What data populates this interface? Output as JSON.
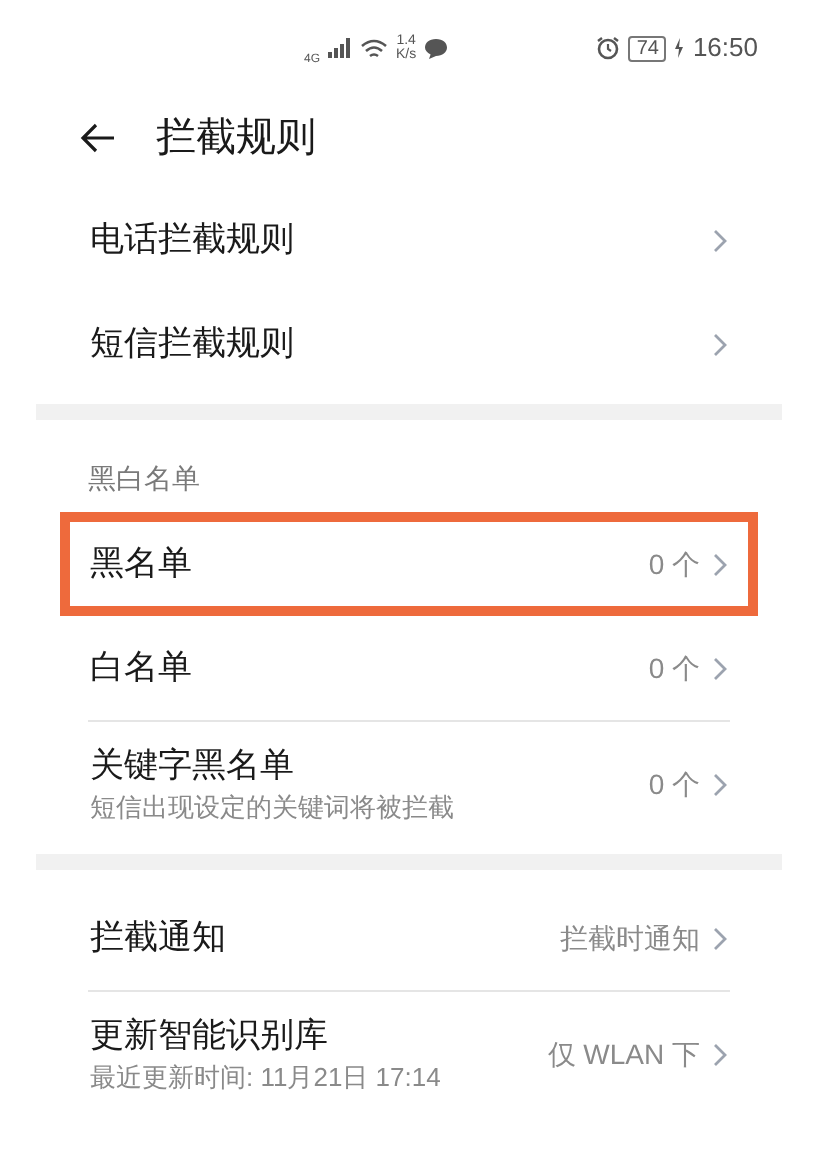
{
  "status_bar": {
    "network_type": "4G",
    "speed_value": "1.4",
    "speed_unit": "K/s",
    "battery": "74",
    "time": "16:50"
  },
  "header": {
    "title": "拦截规则"
  },
  "groups": [
    {
      "items": [
        {
          "title": "电话拦截规则",
          "highlighted": false,
          "divider_above": false
        },
        {
          "title": "短信拦截规则",
          "highlighted": false,
          "divider_above": false
        }
      ]
    },
    {
      "header": "黑白名单",
      "items": [
        {
          "title": "黑名单",
          "value": "0 个",
          "highlighted": true,
          "divider_above": false
        },
        {
          "title": "白名单",
          "value": "0 个",
          "highlighted": false,
          "divider_above": false
        },
        {
          "title": "关键字黑名单",
          "subtitle": "短信出现设定的关键词将被拦截",
          "value": "0 个",
          "highlighted": false,
          "divider_above": true
        }
      ]
    },
    {
      "items": [
        {
          "title": "拦截通知",
          "value": "拦截时通知",
          "highlighted": false,
          "divider_above": false
        },
        {
          "title": "更新智能识别库",
          "subtitle": "最近更新时间: 11月21日 17:14",
          "value": "仅 WLAN 下",
          "highlighted": false,
          "divider_above": true
        }
      ]
    }
  ]
}
